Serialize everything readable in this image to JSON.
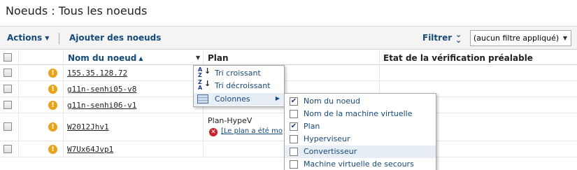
{
  "page": {
    "title": "Noeuds :  Tous les noeuds"
  },
  "toolbar": {
    "actions_label": "Actions",
    "add_nodes_label": "Ajouter des noeuds",
    "filter_label": "Filtrer",
    "filter_value": "(aucun filtre appliqué)"
  },
  "table": {
    "headers": {
      "node_name": "Nom du noeud",
      "plan": "Plan",
      "precheck": "Etat de la vérification préalable"
    },
    "rows": [
      {
        "name": "155.35.128.72",
        "plan": "",
        "status": ""
      },
      {
        "name": "g11n-senhi05-v8",
        "plan": "",
        "status": ""
      },
      {
        "name": "g11n-senhi06-v1",
        "plan": "",
        "status": ""
      },
      {
        "name": "W2012Jhv1",
        "plan": "Plan-HypeV",
        "status": "[Le plan a été modi"
      },
      {
        "name": "W7Ux64Jvp1",
        "plan": "",
        "status": ""
      }
    ]
  },
  "context_menu": {
    "sort_asc": "Tri croissant",
    "sort_desc": "Tri décroissant",
    "columns": "Colonnes"
  },
  "columns_submenu": [
    {
      "label": "Nom du noeud",
      "checked": true
    },
    {
      "label": "Nom de la machine virtuelle",
      "checked": false
    },
    {
      "label": "Plan",
      "checked": true
    },
    {
      "label": "Hyperviseur",
      "checked": false
    },
    {
      "label": "Convertisseur",
      "checked": false
    },
    {
      "label": "Machine virtuelle de secours",
      "checked": false
    }
  ]
}
